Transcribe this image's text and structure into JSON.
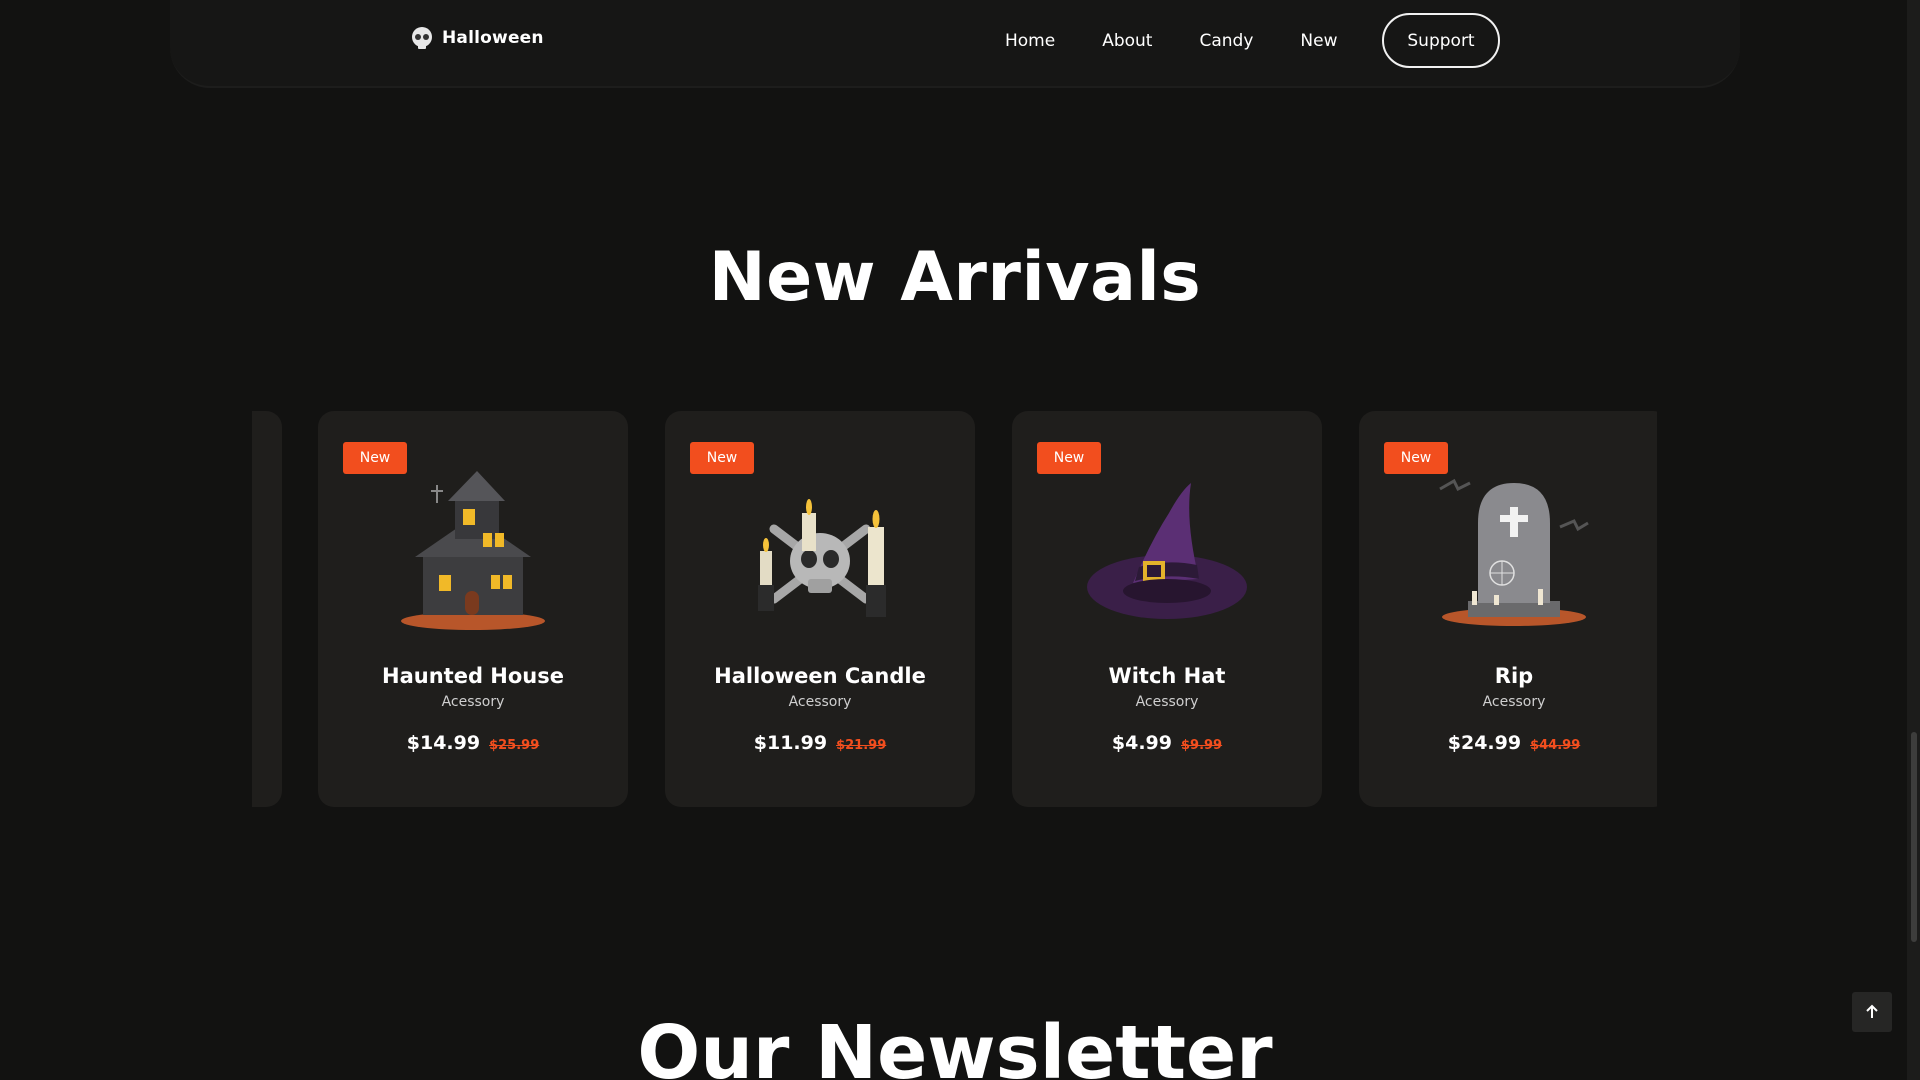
{
  "header": {
    "logo_text": "Halloween",
    "nav": [
      "Home",
      "About",
      "Candy",
      "New"
    ],
    "support_label": "Support"
  },
  "sections": {
    "arrivals_title": "New Arrivals",
    "newsletter_title": "Our Newsletter"
  },
  "products": [
    {
      "badge": "New",
      "name": "Haunted House",
      "category": "Acessory",
      "price": "$14.99",
      "old_price": "$25.99",
      "icon": "haunted-house"
    },
    {
      "badge": "New",
      "name": "Halloween Candle",
      "category": "Acessory",
      "price": "$11.99",
      "old_price": "$21.99",
      "icon": "skull-candles"
    },
    {
      "badge": "New",
      "name": "Witch Hat",
      "category": "Acessory",
      "price": "$4.99",
      "old_price": "$9.99",
      "icon": "witch-hat"
    },
    {
      "badge": "New",
      "name": "Rip",
      "category": "Acessory",
      "price": "$24.99",
      "old_price": "$44.99",
      "icon": "tombstone"
    }
  ],
  "colors": {
    "background": "#121211",
    "card": "#1f1e1c",
    "accent": "#f24e1e"
  }
}
